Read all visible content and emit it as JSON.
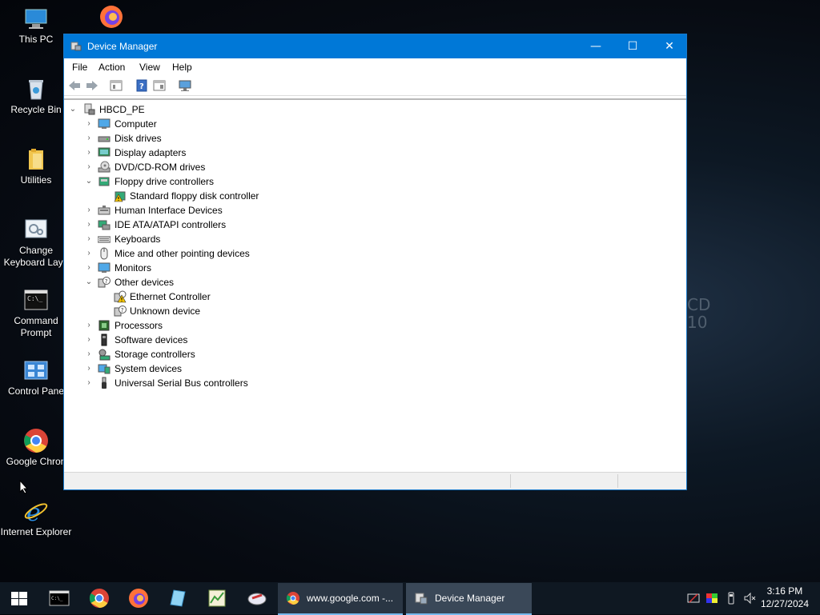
{
  "desktop": {
    "icons": [
      {
        "label": "This PC"
      },
      {
        "label": "Recycle Bin"
      },
      {
        "label": "Utilities"
      },
      {
        "label_line1": "Change",
        "label_line2": "Keyboard Layo"
      },
      {
        "label_line1": "Command",
        "label_line2": "Prompt"
      },
      {
        "label": "Control Pane"
      },
      {
        "label": "Google Chron"
      },
      {
        "label": "Internet Explorer"
      }
    ],
    "wallpaper_text": [
      "CD",
      "10"
    ]
  },
  "window": {
    "title": "Device Manager",
    "menu": [
      "File",
      "Action",
      "View",
      "Help"
    ],
    "controls": {
      "minimize": "—",
      "maximize": "☐",
      "close": "✕"
    }
  },
  "tree": {
    "root": "HBCD_PE",
    "categories": [
      {
        "label": "Computer",
        "expanded": false
      },
      {
        "label": "Disk drives",
        "expanded": false
      },
      {
        "label": "Display adapters",
        "expanded": false
      },
      {
        "label": "DVD/CD-ROM drives",
        "expanded": false
      },
      {
        "label": "Floppy drive controllers",
        "expanded": true,
        "children": [
          {
            "label": "Standard floppy disk controller",
            "warning": true
          }
        ]
      },
      {
        "label": "Human Interface Devices",
        "expanded": false
      },
      {
        "label": "IDE ATA/ATAPI controllers",
        "expanded": false
      },
      {
        "label": "Keyboards",
        "expanded": false
      },
      {
        "label": "Mice and other pointing devices",
        "expanded": false
      },
      {
        "label": "Monitors",
        "expanded": false
      },
      {
        "label": "Other devices",
        "expanded": true,
        "children": [
          {
            "label": "Ethernet Controller",
            "warning": true
          },
          {
            "label": "Unknown device",
            "warning": false
          }
        ]
      },
      {
        "label": "Processors",
        "expanded": false
      },
      {
        "label": "Software devices",
        "expanded": false
      },
      {
        "label": "Storage controllers",
        "expanded": false
      },
      {
        "label": "System devices",
        "expanded": false
      },
      {
        "label": "Universal Serial Bus controllers",
        "expanded": false
      }
    ]
  },
  "taskbar": {
    "windows": [
      {
        "label": "www.google.com -..."
      },
      {
        "label": "Device Manager"
      }
    ],
    "clock": {
      "time": "3:16 PM",
      "date": "12/27/2024"
    }
  },
  "colors": {
    "titlebar": "#0078d7",
    "taskbar": "#0f1822",
    "accent": "#1979ca"
  }
}
